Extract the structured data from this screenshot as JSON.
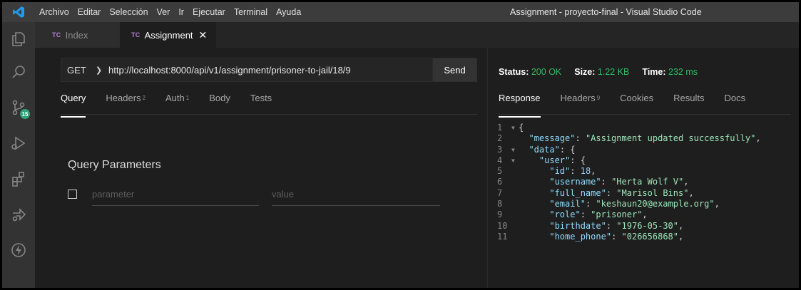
{
  "titlebar": {
    "menu": [
      "Archivo",
      "Editar",
      "Selección",
      "Ver",
      "Ir",
      "Ejecutar",
      "Terminal",
      "Ayuda"
    ],
    "window_title": "Assignment - proyecto-final - Visual Studio Code"
  },
  "activitybar": {
    "items": [
      "explorer-icon",
      "search-icon",
      "source-control-icon",
      "run-debug-icon",
      "extensions-icon",
      "remote-icon",
      "thunder-client-icon"
    ],
    "source_control_badge": "15"
  },
  "tabs": [
    {
      "prefix": "TC",
      "label": "Index",
      "active": false
    },
    {
      "prefix": "TC",
      "label": "Assignment",
      "active": true,
      "close": "✕"
    }
  ],
  "request": {
    "method": "GET",
    "url": "http://localhost:8000/api/v1/assignment/prisoner-to-jail/18/9",
    "send_label": "Send"
  },
  "request_tabs": [
    {
      "label": "Query",
      "sup": ""
    },
    {
      "label": "Headers",
      "sup": "2"
    },
    {
      "label": "Auth",
      "sup": "1"
    },
    {
      "label": "Body",
      "sup": ""
    },
    {
      "label": "Tests",
      "sup": ""
    }
  ],
  "query": {
    "title": "Query Parameters",
    "param_placeholder": "parameter",
    "value_placeholder": "value"
  },
  "response_status": {
    "status_label": "Status:",
    "status_value": "200 OK",
    "size_label": "Size:",
    "size_value": "1.22 KB",
    "time_label": "Time:",
    "time_value": "232 ms"
  },
  "response_tabs": [
    {
      "label": "Response",
      "sup": ""
    },
    {
      "label": "Headers",
      "sup": "9"
    },
    {
      "label": "Cookies",
      "sup": ""
    },
    {
      "label": "Results",
      "sup": ""
    },
    {
      "label": "Docs",
      "sup": ""
    }
  ],
  "response_body": [
    {
      "n": "1",
      "fold": true,
      "indent": "",
      "parts": [
        [
          "punc",
          "{"
        ]
      ]
    },
    {
      "n": "2",
      "fold": false,
      "indent": "  ",
      "parts": [
        [
          "key",
          "\"message\""
        ],
        [
          "punc",
          ": "
        ],
        [
          "strg",
          "\"Assignment updated successfully\""
        ],
        [
          "punc",
          ","
        ]
      ]
    },
    {
      "n": "3",
      "fold": true,
      "indent": "  ",
      "parts": [
        [
          "key",
          "\"data\""
        ],
        [
          "punc",
          ": {"
        ]
      ]
    },
    {
      "n": "4",
      "fold": true,
      "indent": "    ",
      "parts": [
        [
          "key",
          "\"user\""
        ],
        [
          "punc",
          ": {"
        ]
      ]
    },
    {
      "n": "5",
      "fold": false,
      "indent": "      ",
      "parts": [
        [
          "key",
          "\"id\""
        ],
        [
          "punc",
          ": "
        ],
        [
          "num",
          "18"
        ],
        [
          "punc",
          ","
        ]
      ]
    },
    {
      "n": "6",
      "fold": false,
      "indent": "      ",
      "parts": [
        [
          "key",
          "\"username\""
        ],
        [
          "punc",
          ": "
        ],
        [
          "strg",
          "\"Herta Wolf V\""
        ],
        [
          "punc",
          ","
        ]
      ]
    },
    {
      "n": "7",
      "fold": false,
      "indent": "      ",
      "parts": [
        [
          "key",
          "\"full_name\""
        ],
        [
          "punc",
          ": "
        ],
        [
          "strg",
          "\"Marisol Bins\""
        ],
        [
          "punc",
          ","
        ]
      ]
    },
    {
      "n": "8",
      "fold": false,
      "indent": "      ",
      "parts": [
        [
          "key",
          "\"email\""
        ],
        [
          "punc",
          ": "
        ],
        [
          "strg",
          "\"keshaun20@example.org\""
        ],
        [
          "punc",
          ","
        ]
      ]
    },
    {
      "n": "9",
      "fold": false,
      "indent": "      ",
      "parts": [
        [
          "key",
          "\"role\""
        ],
        [
          "punc",
          ": "
        ],
        [
          "strg",
          "\"prisoner\""
        ],
        [
          "punc",
          ","
        ]
      ]
    },
    {
      "n": "10",
      "fold": false,
      "indent": "      ",
      "parts": [
        [
          "key",
          "\"birthdate\""
        ],
        [
          "punc",
          ": "
        ],
        [
          "strg",
          "\"1976-05-30\""
        ],
        [
          "punc",
          ","
        ]
      ]
    },
    {
      "n": "11",
      "fold": false,
      "indent": "      ",
      "parts": [
        [
          "key",
          "\"home_phone\""
        ],
        [
          "punc",
          ": "
        ],
        [
          "strg",
          "\"026656868\""
        ],
        [
          "punc",
          ","
        ]
      ]
    }
  ],
  "colors": {
    "accent_green": "#2fba63",
    "json_key": "#8fdcfe",
    "json_string": "#9ee6b9",
    "tc_purple": "#b180d7"
  }
}
